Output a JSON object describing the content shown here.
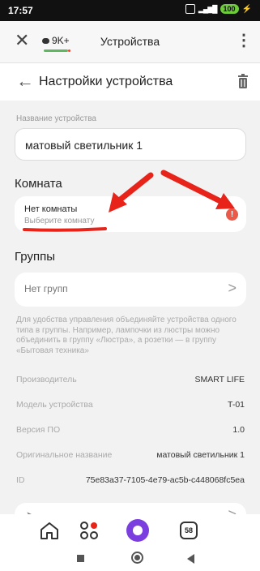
{
  "status_bar": {
    "time": "17:57",
    "battery": "100"
  },
  "browser": {
    "title": "Устройства",
    "count": "9K+",
    "menu_icon": "⋮"
  },
  "header": {
    "title": "Настройки устройства"
  },
  "device_name": {
    "label": "Название устройства",
    "value": "матовый светильник 1"
  },
  "room": {
    "section_title": "Комната",
    "title": "Нет комнаты",
    "subtitle": "Выберите комнату",
    "warn_symbol": "!"
  },
  "groups": {
    "section_title": "Группы",
    "label": "Нет групп",
    "hint": "Для удобства управления объединяйте устройства одного типа в группы. Например, лампочки из люстры можно объединить в группу «Люстра», а розетки — в группу «Бытовая техника»"
  },
  "info": [
    {
      "key": "Производитель",
      "value": "SMART LIFE"
    },
    {
      "key": "Модель устройства",
      "value": "T-01"
    },
    {
      "key": "Версия ПО",
      "value": "1.0"
    },
    {
      "key": "Оригинальное название",
      "value": "матовый светильник 1"
    },
    {
      "key": "ID",
      "value": "75e83a37-7105-4e79-ac5b-c448068fc5ea"
    }
  ],
  "tab_bar": {
    "notification_count": "58"
  },
  "colors": {
    "accent_purple": "#7b3fe0",
    "warning_red": "#ea5a4a",
    "annotation_red": "#e8231a"
  }
}
